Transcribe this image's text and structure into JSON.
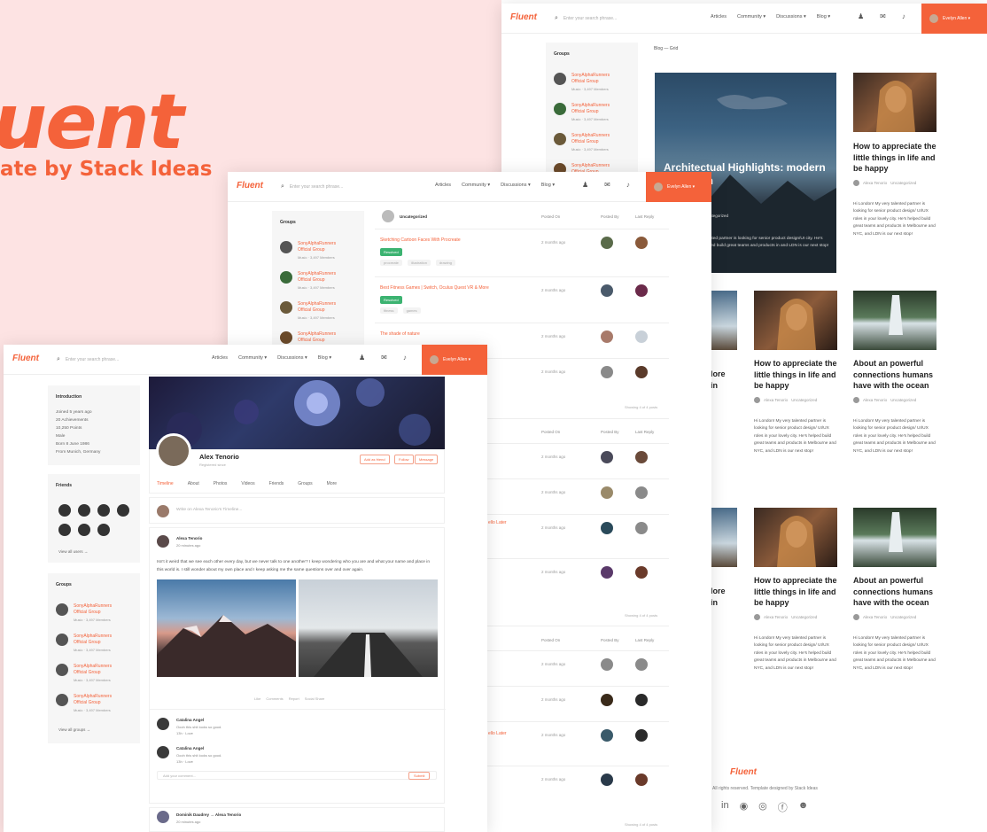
{
  "hero": {
    "logo": "uent",
    "tagline": "ate by Stack Ideas"
  },
  "nav": {
    "logo": "Fluent",
    "search_placeholder": "Enter your search phrase...",
    "links": [
      "Articles",
      "Community ▾",
      "Discussions ▾",
      "Blog ▾"
    ],
    "user": "Evelyn Allen ▾"
  },
  "groups_title": "Groups",
  "group": {
    "name": "SonyAlphaRunners Official Group",
    "meta": "Music · 3,497 Members"
  },
  "blog": {
    "breadcrumb": "Blog — Grid",
    "featured_title": "Architectual Highlights: modern houses in",
    "featured_category": "Uncategorized",
    "featured_excerpt": "talented partner is looking for senior product design/UI city. He's helped build great teams and products in and LDN is our next stop!",
    "post_title": "How to appreciate the little things in life and be happy",
    "post_title_b": "About an powerful connections humans have with the ocean",
    "partial_titles": [
      "lore",
      "in"
    ],
    "author": "Alexa Tenorio",
    "category": "Uncategorized",
    "excerpt": "Hi London! My very talented partner is looking for senior product design/ UI/UX roles in your lovely city. He's helped build great teams and products in Melbourne and NYC, and LDN is our next stop!",
    "footer_copy": "All rights reserved. Template designed by Stack Ideas"
  },
  "forum": {
    "category": "Uncategorized",
    "columns": [
      "Posted On",
      "Posted By",
      "Last Reply"
    ],
    "rows": [
      {
        "title": "Sketching Cartoon Faces With Procreate",
        "badge": "Resolved",
        "tags": [
          "procreate",
          "illustration",
          "drawing"
        ],
        "date": "2 months ago"
      },
      {
        "title": "Best Fitness Games | Switch, Oculus Quest VR & More",
        "badge": "Resolved",
        "tags": [
          "fitness",
          "games"
        ],
        "date": "2 months ago"
      },
      {
        "title": "The shade of nature",
        "date": "2 months ago"
      },
      {
        "title": "",
        "date": "2 months ago"
      }
    ],
    "showing": "Showing 4 of 4 posts",
    "more_dates": [
      "2 months ago",
      "2 months ago",
      "2 months ago",
      "2 months ago",
      "2 months ago",
      "2 months ago",
      "2 months ago",
      "2 months ago",
      "2 months ago"
    ],
    "partial_link": "ello Later"
  },
  "profile": {
    "name": "Alex Tenorio",
    "sub": "Registered since",
    "buttons": [
      "Add as friend",
      "Follow",
      "Message"
    ],
    "tabs": [
      "Timeline",
      "About",
      "Photos",
      "Videos",
      "Friends",
      "Groups",
      "More"
    ],
    "intro_title": "Introduction",
    "intro": [
      "Joined 5 years ago",
      "20 Achievements",
      "10,250 Points",
      "Male",
      "Born 8 June 1986",
      "From Munich, Germany"
    ],
    "friends_title": "Friends",
    "view_all": "View all users →",
    "view_groups": "View all groups →",
    "composer": "Write on Alexa Tenorio's Timeline...",
    "post_author": "Alexa Tenorio",
    "post_time": "20 minutes ago",
    "post_text": "Isn't it weird that we see each other every day, but we never talk to one another? I keep wondering who you are and what your name and place in this world is. I still wonder about my own place and I keep asking me the same questions over and over again.",
    "post_actions": [
      "Like",
      "Comments",
      "Report",
      "Social Share"
    ],
    "comments": [
      {
        "name": "Catalina Angel",
        "text": "Oooh this shit looks so good.",
        "meta": "13h · Love"
      },
      {
        "name": "Catalina Angel",
        "text": "Oooh this shit looks so good.",
        "meta": "13h · Love"
      }
    ],
    "comment_placeholder": "Add your comment...",
    "submit": "Submit",
    "next_post": "Dominik Daudrey → Alexa Tenorio",
    "next_time": "20 minutes ago"
  },
  "colors": {
    "accent": "#f4623a",
    "hero_bg": "#fde3e3",
    "resolved": "#3cb371"
  }
}
